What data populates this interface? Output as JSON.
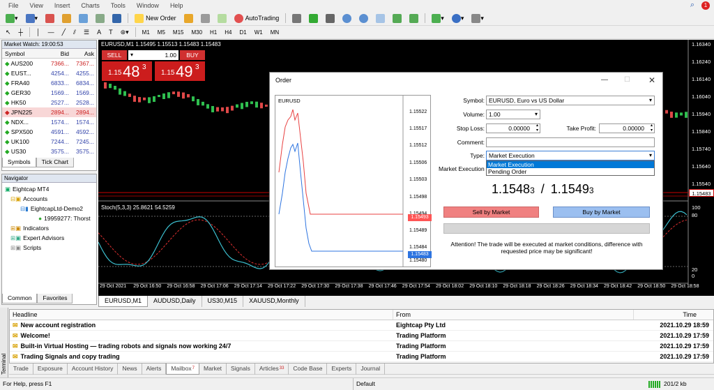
{
  "menu": [
    "File",
    "View",
    "Insert",
    "Charts",
    "Tools",
    "Window",
    "Help"
  ],
  "toolbar": {
    "new_order": "New Order",
    "autotrading": "AutoTrading",
    "timeframes": [
      "M1",
      "M5",
      "M15",
      "M30",
      "H1",
      "H4",
      "D1",
      "W1",
      "MN"
    ],
    "notify_count": "1"
  },
  "market_watch": {
    "title": "Market Watch: 19:00:53",
    "cols": [
      "Symbol",
      "Bid",
      "Ask"
    ],
    "rows": [
      {
        "s": "AUS200",
        "b": "7366...",
        "a": "7367..."
      },
      {
        "s": "EUST...",
        "b": "4254...",
        "a": "4255..."
      },
      {
        "s": "FRA40",
        "b": "6833...",
        "a": "6834..."
      },
      {
        "s": "GER30",
        "b": "1569...",
        "a": "1569..."
      },
      {
        "s": "HK50",
        "b": "2527...",
        "a": "2528..."
      },
      {
        "s": "JPN225",
        "b": "2894...",
        "a": "2894..."
      },
      {
        "s": "NDX...",
        "b": "1574...",
        "a": "1574..."
      },
      {
        "s": "SPX500",
        "b": "4591...",
        "a": "4592..."
      },
      {
        "s": "UK100",
        "b": "7244...",
        "a": "7245..."
      },
      {
        "s": "US30",
        "b": "3575...",
        "a": "3575..."
      }
    ],
    "tabs": [
      "Symbols",
      "Tick Chart"
    ]
  },
  "navigator": {
    "title": "Navigator",
    "items": [
      "Eightcap MT4",
      "Accounts",
      "EightcapLtd-Demo2",
      "19959277: Thorst",
      "Indicators",
      "Expert Advisors",
      "Scripts"
    ],
    "tabs": [
      "Common",
      "Favorites"
    ]
  },
  "chart": {
    "header": "EURUSD,M1  1.15495 1.15513 1.15483 1.15483",
    "sell": "SELL",
    "buy": "BUY",
    "lot": "1.00",
    "sell_price": {
      "pre": "1.15",
      "big": "48",
      "sup": "3"
    },
    "buy_price": {
      "pre": "1.15",
      "big": "49",
      "sup": "3"
    },
    "price_axis": [
      "1.16340",
      "1.16240",
      "1.16140",
      "1.16040",
      "1.15940",
      "1.15840",
      "1.15740",
      "1.15640",
      "1.15540"
    ],
    "current": "1.15483",
    "stoch_label": "Stoch(5,3,3) 25.8621 54.5259",
    "stoch_axis": [
      "100",
      "80",
      "20",
      "0"
    ],
    "time_axis": [
      "29 Oct 2021",
      "29 Oct 16:50",
      "29 Oct 16:58",
      "29 Oct 17:06",
      "29 Oct 17:14",
      "29 Oct 17:22",
      "29 Oct 17:30",
      "29 Oct 17:38",
      "29 Oct 17:46",
      "29 Oct 17:54",
      "29 Oct 18:02",
      "29 Oct 18:10",
      "29 Oct 18:18",
      "29 Oct 18:26",
      "29 Oct 18:34",
      "29 Oct 18:42",
      "29 Oct 18:50",
      "29 Oct 18:58"
    ],
    "tabs": [
      "EURUSD,M1",
      "AUDUSD,Daily",
      "US30,M15",
      "XAUUSD,Monthly"
    ]
  },
  "order": {
    "title": "Order",
    "mini_symbol": "EURUSD",
    "mini_axis": [
      "1.15522",
      "1.15517",
      "1.15512",
      "1.15506",
      "1.15503",
      "1.15498",
      "1.15494",
      "1.15489",
      "1.15484",
      "1.15480"
    ],
    "mini_red": "1.15493",
    "mini_blue": "1.15483",
    "symbol_label": "Symbol:",
    "symbol": "EURUSD, Euro vs US Dollar",
    "volume_label": "Volume:",
    "volume": "1.00",
    "sl_label": "Stop Loss:",
    "sl": "0.00000",
    "tp_label": "Take Profit:",
    "tp": "0.00000",
    "comment_label": "Comment:",
    "type_label": "Type:",
    "type": "Market Execution",
    "options": [
      "Market Execution",
      "Pending Order"
    ],
    "market_exec_label": "Market Execution",
    "bid": {
      "main": "1.1548",
      "small": "3"
    },
    "ask": {
      "main": "1.1549",
      "small": "3"
    },
    "slash": "/",
    "sell_btn": "Sell by Market",
    "buy_btn": "Buy by Market",
    "warning": "Attention! The trade will be executed at market conditions, difference with requested price may be significant!"
  },
  "terminal": {
    "cols": [
      "Headline",
      "From",
      "Time"
    ],
    "rows": [
      {
        "h": "New account registration",
        "f": "Eightcap Pty Ltd",
        "t": "2021.10.29 18:59"
      },
      {
        "h": "Welcome!",
        "f": "Trading Platform",
        "t": "2021.10.29 17:59"
      },
      {
        "h": "Built-in Virtual Hosting — trading robots and signals now working 24/7",
        "f": "Trading Platform",
        "t": "2021.10.29 17:59"
      },
      {
        "h": "Trading Signals and copy trading",
        "f": "Trading Platform",
        "t": "2021.10.29 17:59"
      }
    ],
    "side": "Terminal",
    "tabs": [
      "Trade",
      "Exposure",
      "Account History",
      "News",
      "Alerts",
      "Mailbox",
      "Market",
      "Signals",
      "Articles",
      "Code Base",
      "Experts",
      "Journal"
    ],
    "mailbox_badge": "7",
    "articles_badge": "33"
  },
  "status": {
    "help": "For Help, press F1",
    "profile": "Default",
    "traffic": "201/2 kb"
  }
}
